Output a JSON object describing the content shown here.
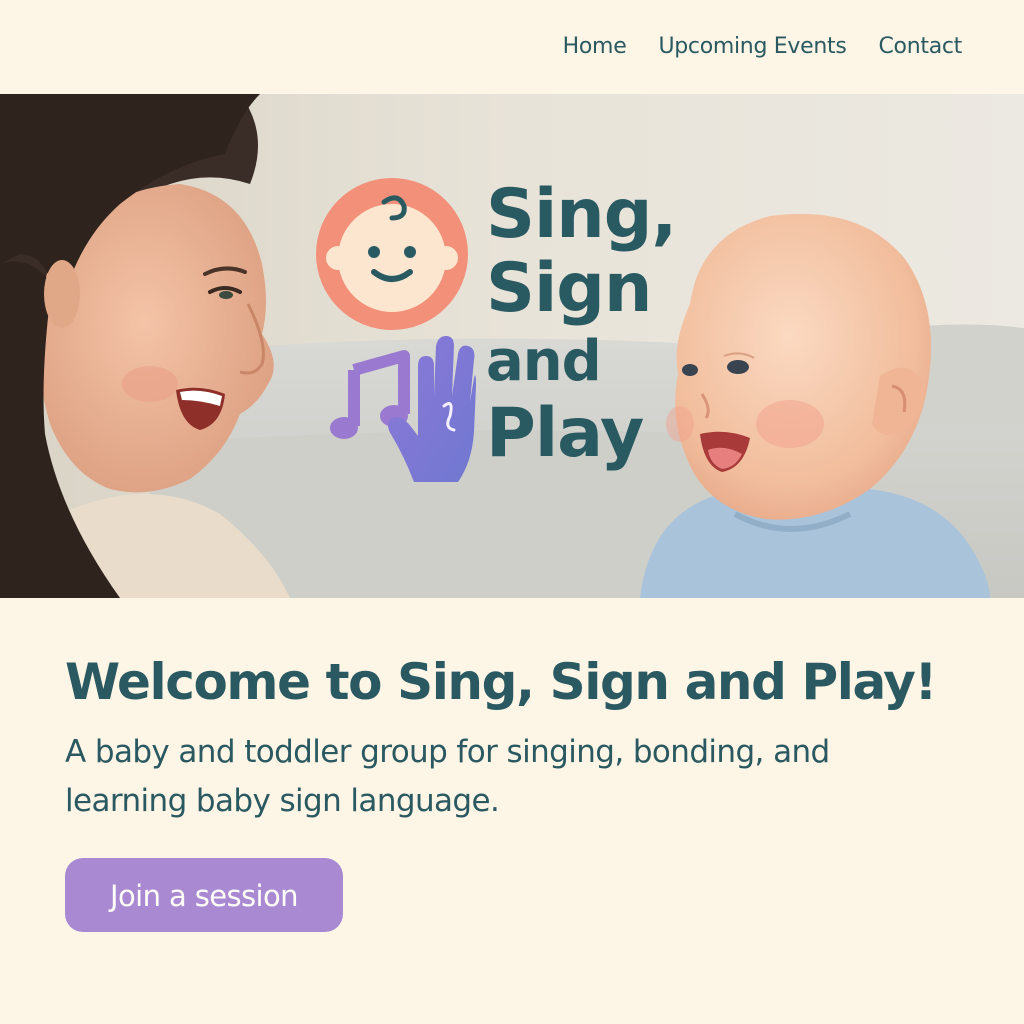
{
  "nav": {
    "items": [
      {
        "label": "Home"
      },
      {
        "label": "Upcoming Events"
      },
      {
        "label": "Contact"
      }
    ]
  },
  "hero": {
    "logo": {
      "title_lines": [
        "Sing,",
        "Sign",
        "and",
        "Play"
      ],
      "icons": [
        "baby-face-icon",
        "music-note-icon",
        "hand-sign-icon"
      ]
    },
    "photo_description_icon": "mother-and-baby-photo"
  },
  "main": {
    "title": "Welcome to Sing, Sign and Play!",
    "subtitle": "A baby and toddler group for singing, bonding, and learning baby sign language.",
    "cta_label": "Join a session"
  },
  "colors": {
    "background": "#fdf5e6",
    "text": "#2b5961",
    "accent_purple": "#a98ad2",
    "logo_coral": "#f3907a",
    "logo_violet": "#8a78d6"
  }
}
